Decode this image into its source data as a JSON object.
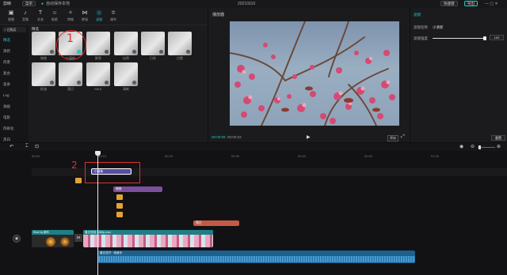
{
  "app": {
    "name": "剪映",
    "menu_label": "菜单",
    "autosave_text": "自动保存本地",
    "project_date": "20210310",
    "shortcut_label": "快捷键",
    "export_label": "导出"
  },
  "toolbar": {
    "tools": [
      {
        "label": "视频",
        "icon": "▣"
      },
      {
        "label": "音频",
        "icon": "♪"
      },
      {
        "label": "文本",
        "icon": "T"
      },
      {
        "label": "贴纸",
        "icon": "☺"
      },
      {
        "label": "特效",
        "icon": "✧"
      },
      {
        "label": "转场",
        "icon": "⋈"
      },
      {
        "label": "滤镜",
        "icon": "◎"
      },
      {
        "label": "调节",
        "icon": "≑"
      }
    ]
  },
  "nav": {
    "button_label": "+ 已购买",
    "items": [
      "精选",
      "清新",
      "风景",
      "复古",
      "美食",
      "Log",
      "油画",
      "电影",
      "风格化",
      "黑白"
    ]
  },
  "effects": {
    "section_title": "精选",
    "items": [
      "暗夜",
      "小清新",
      "鲜亮",
      "自然",
      "日系",
      "白皙",
      "奶油",
      "落日",
      "MILK",
      "清新"
    ]
  },
  "player": {
    "header": "播放器",
    "time_current": "00:00:09",
    "time_total": "00:00:53",
    "ratio_label": "原始"
  },
  "properties": {
    "tab": "滤镜",
    "filter_name_label": "滤镜名称",
    "filter_name_value": "小清新",
    "intensity_label": "滤镜强度",
    "intensity_value": "100",
    "intensity_fraction": 1.0,
    "reset_label": "重置"
  },
  "timeline": {
    "ticks": [
      "00:00",
      "00:10",
      "00:20",
      "00:30",
      "00:40",
      "00:50",
      "01:00"
    ],
    "filter_clip": "小清新",
    "effect_clip": "暗夜",
    "sticker_clip": "落日",
    "video1_label": "Shot by 蜗牛",
    "video2_label": "春日花枝 1080p.mov",
    "audio_label": "春日花开 · 轻音乐"
  },
  "annotations": {
    "one": "1",
    "two": "2"
  },
  "colors": {
    "accent": "#20c6c6",
    "annotation": "#e0302f",
    "filter_clip": "#5a4ba8",
    "effect_clip": "#7c4f9c",
    "video_track": "#1f7f86",
    "audio_track": "#1d5f8d"
  }
}
